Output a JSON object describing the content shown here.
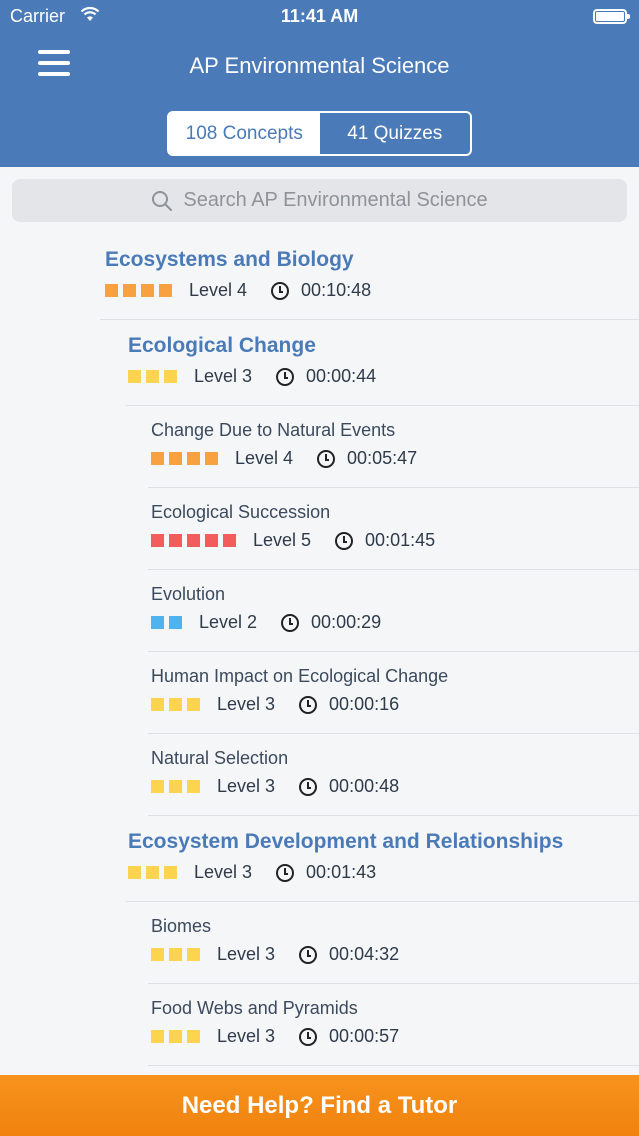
{
  "status_bar": {
    "carrier": "Carrier",
    "time": "11:41 AM"
  },
  "header": {
    "title": "AP Environmental Science",
    "tabs": [
      {
        "label": "108 Concepts",
        "active": true
      },
      {
        "label": "41 Quizzes",
        "active": false
      }
    ]
  },
  "search": {
    "placeholder": "Search AP Environmental Science"
  },
  "level_colors": {
    "2": "#4fb3f0",
    "3": "#fcd44f",
    "4": "#f7a140",
    "5": "#f25c5c"
  },
  "items": [
    {
      "name": "Ecosystems and Biology",
      "level": 4,
      "level_label": "Level 4",
      "time": "00:10:48",
      "depth": 1
    },
    {
      "name": "Ecological Change",
      "level": 3,
      "level_label": "Level 3",
      "time": "00:00:44",
      "depth": 2
    },
    {
      "name": "Change Due to Natural Events",
      "level": 4,
      "level_label": "Level 4",
      "time": "00:05:47",
      "depth": 3
    },
    {
      "name": "Ecological Succession",
      "level": 5,
      "level_label": "Level 5",
      "time": "00:01:45",
      "depth": 3
    },
    {
      "name": "Evolution",
      "level": 2,
      "level_label": "Level 2",
      "time": "00:00:29",
      "depth": 3
    },
    {
      "name": "Human Impact on Ecological Change",
      "level": 3,
      "level_label": "Level 3",
      "time": "00:00:16",
      "depth": 3
    },
    {
      "name": "Natural Selection",
      "level": 3,
      "level_label": "Level 3",
      "time": "00:00:48",
      "depth": 3
    },
    {
      "name": "Ecosystem Development and Relationships",
      "level": 3,
      "level_label": "Level 3",
      "time": "00:01:43",
      "depth": 2
    },
    {
      "name": "Biomes",
      "level": 3,
      "level_label": "Level 3",
      "time": "00:04:32",
      "depth": 3
    },
    {
      "name": "Food Webs and Pyramids",
      "level": 3,
      "level_label": "Level 3",
      "time": "00:00:57",
      "depth": 3
    }
  ],
  "footer": {
    "label": "Need Help?  Find a Tutor"
  }
}
